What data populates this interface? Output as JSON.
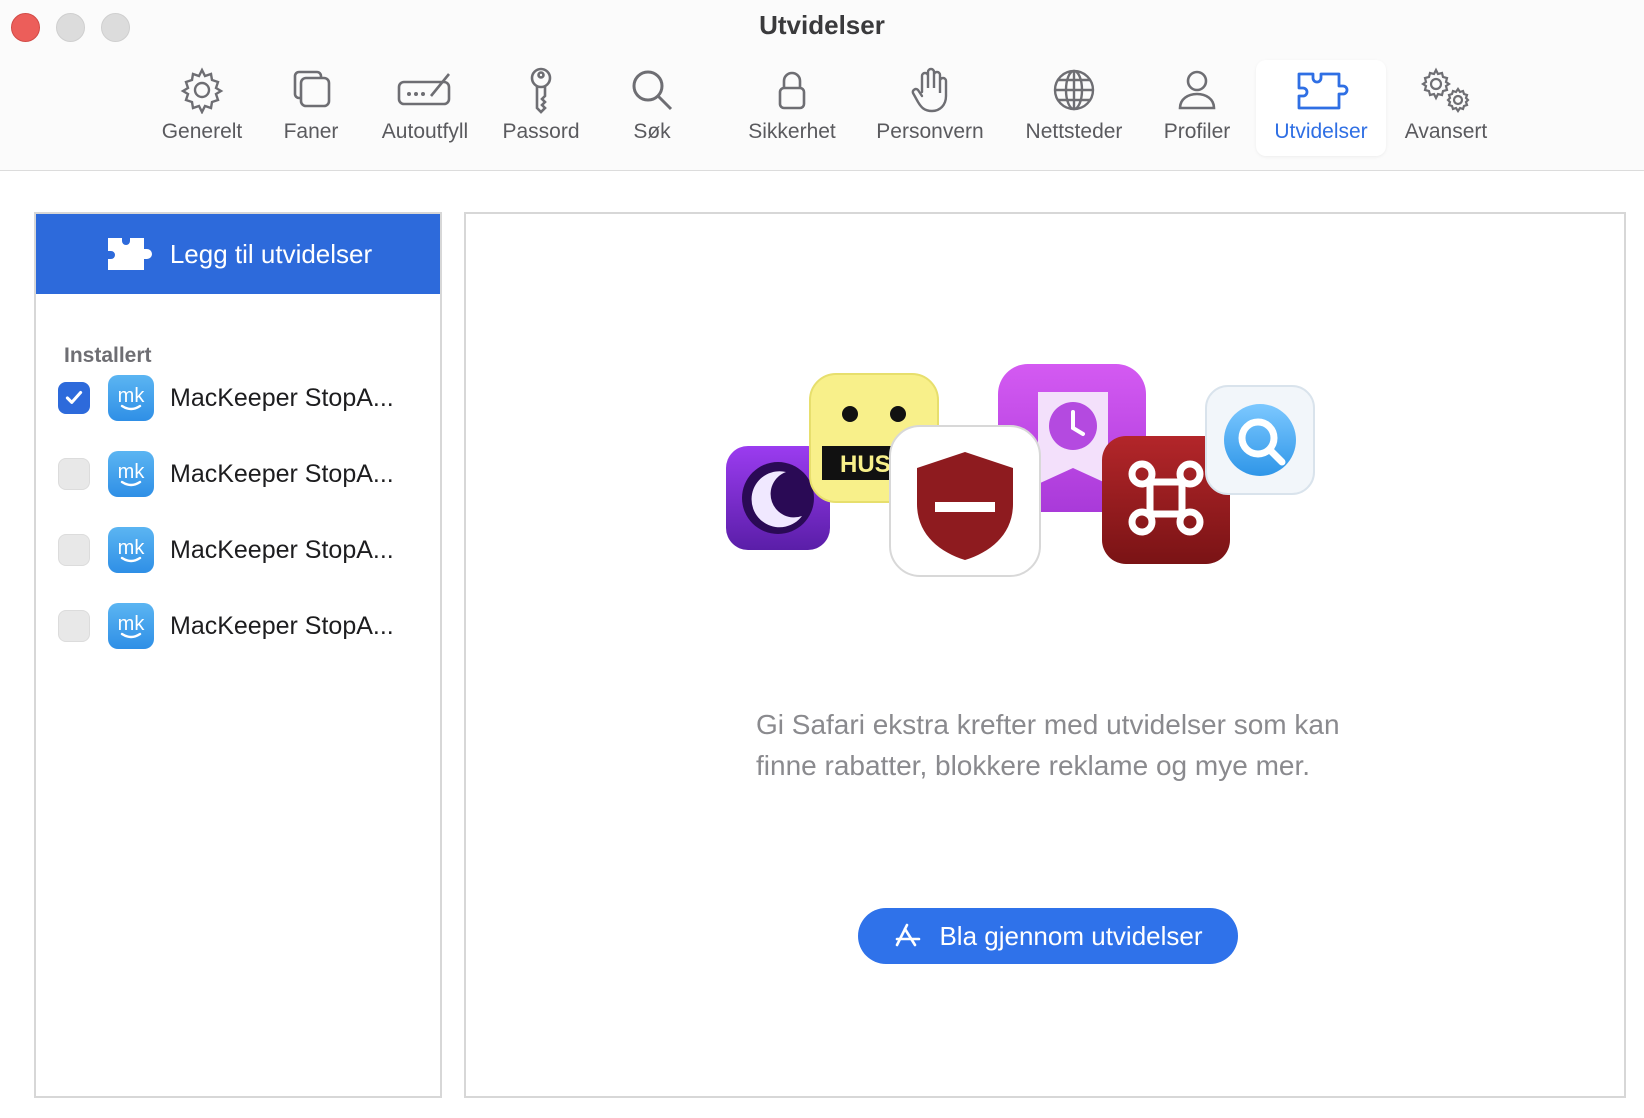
{
  "window": {
    "title": "Utvidelser"
  },
  "toolbar": {
    "items": [
      {
        "label": "Generelt",
        "icon": "gear-icon"
      },
      {
        "label": "Faner",
        "icon": "tabs-icon"
      },
      {
        "label": "Autoutfyll",
        "icon": "autofill-icon"
      },
      {
        "label": "Passord",
        "icon": "key-icon"
      },
      {
        "label": "Søk",
        "icon": "search-icon"
      },
      {
        "label": "Sikkerhet",
        "icon": "lock-icon"
      },
      {
        "label": "Personvern",
        "icon": "hand-icon"
      },
      {
        "label": "Nettsteder",
        "icon": "globe-icon"
      },
      {
        "label": "Profiler",
        "icon": "person-icon"
      },
      {
        "label": "Utvidelser",
        "icon": "puzzle-icon",
        "active": true
      },
      {
        "label": "Avansert",
        "icon": "gears-icon"
      }
    ],
    "accent": "#2f6fe4"
  },
  "sidebar": {
    "add_button": "Legg til utvidelser",
    "section_title": "Installert",
    "extensions": [
      {
        "name": "MacKeeper StopA...",
        "enabled": true
      },
      {
        "name": "MacKeeper StopA...",
        "enabled": false
      },
      {
        "name": "MacKeeper StopA...",
        "enabled": false
      },
      {
        "name": "MacKeeper StopA...",
        "enabled": false
      }
    ]
  },
  "main": {
    "description": "Gi Safari ekstra krefter med utvidelser som kan finne rabatter, blokkere reklame og mye mer.",
    "browse_button": "Bla gjennom utvidelser",
    "illustration_text": "HUS"
  }
}
